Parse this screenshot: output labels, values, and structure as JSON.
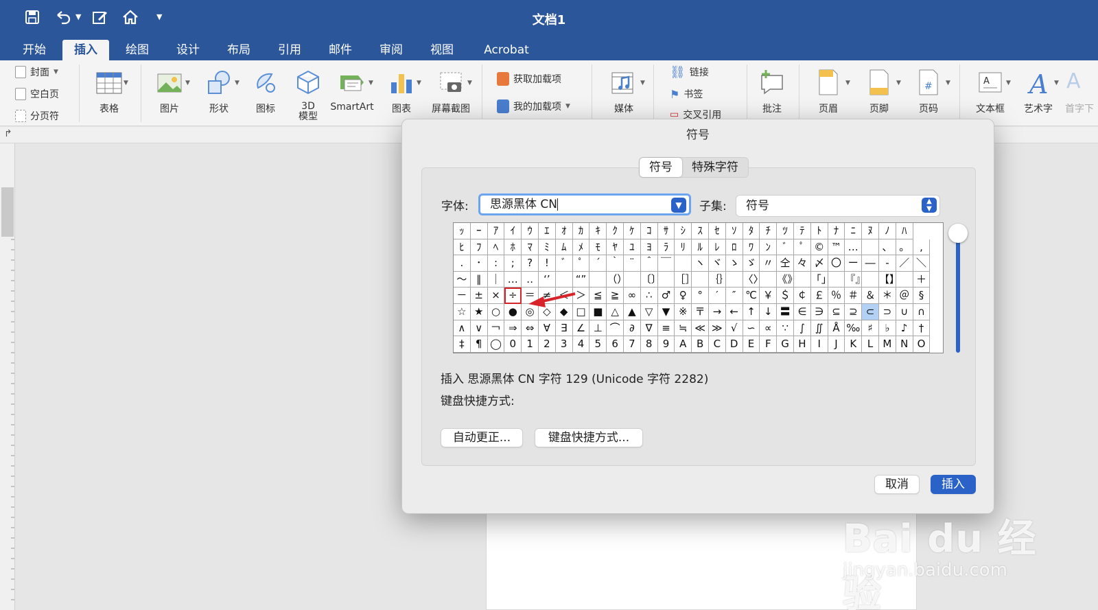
{
  "window": {
    "title": "文档1"
  },
  "quick_access": [
    "save-icon",
    "undo-icon",
    "edit-icon",
    "home-icon",
    "customize-icon"
  ],
  "tabs": [
    "开始",
    "插入",
    "绘图",
    "设计",
    "布局",
    "引用",
    "邮件",
    "审阅",
    "视图",
    "Acrobat"
  ],
  "active_tab": "插入",
  "ribbon": {
    "pages": [
      "封面",
      "空白页",
      "分页符"
    ],
    "table": "表格",
    "picture": "图片",
    "shapes": "形状",
    "icons": "图标",
    "model3d_line1": "3D",
    "model3d_line2": "模型",
    "smartart": "SmartArt",
    "chart": "图表",
    "screenshot": "屏幕截图",
    "get_addins": "获取加载项",
    "my_addins": "我的加载项",
    "media": "媒体",
    "link": "链接",
    "bookmark": "书签",
    "cross_ref": "交叉引用",
    "comment": "批注",
    "header": "页眉",
    "footer": "页脚",
    "page_number": "页码",
    "textbox": "文本框",
    "wordart": "艺术字",
    "dropcap": "首字下"
  },
  "dialog": {
    "title": "符号",
    "tabs": [
      "符号",
      "特殊字符"
    ],
    "font_label": "字体:",
    "font_value": "思源黑体 CN",
    "subset_label": "子集:",
    "subset_value": "符号",
    "info": "插入 思源黑体 CN 字符 129 (Unicode 字符 2282)",
    "shortcut_label": "键盘快捷方式:",
    "autocorrect_btn": "自动更正...",
    "keyboard_btn": "键盘快捷方式...",
    "cancel_btn": "取消",
    "insert_btn": "插入",
    "accent_color": "#2a62c8",
    "highlight_color": "#d8232a",
    "grid": [
      [
        "ｯ",
        "ｰ",
        "ｱ",
        "ｲ",
        "ｳ",
        "ｴ",
        "ｵ",
        "ｶ",
        "ｷ",
        "ｸ",
        "ｹ",
        "ｺ",
        "ｻ",
        "ｼ",
        "ｽ",
        "ｾ",
        "ｿ",
        "ﾀ",
        "ﾁ",
        "ﾂ",
        "ﾃ",
        "ﾄ",
        "ﾅ",
        "ﾆ",
        "ﾇ",
        "ﾉ",
        "ﾊ"
      ],
      [
        "ﾋ",
        "ﾌ",
        "ﾍ",
        "ﾎ",
        "ﾏ",
        "ﾐ",
        "ﾑ",
        "ﾒ",
        "ﾓ",
        "ﾔ",
        "ﾕ",
        "ﾖ",
        "ﾗ",
        "ﾘ",
        "ﾙ",
        "ﾚ",
        "ﾛ",
        "ﾜ",
        "ﾝ",
        "ﾞ",
        "ﾟ",
        "©",
        "™",
        "…",
        "",
        "、",
        "。",
        ","
      ],
      [
        ".",
        "･",
        ":",
        ";",
        "?",
        "!",
        "ﾞ",
        "ﾟ",
        "´",
        "｀",
        "¨",
        "＾",
        "￣",
        "",
        "ヽ",
        "ヾ",
        "ゝ",
        "ゞ",
        "〃",
        "仝",
        "々",
        "〆",
        "〇",
        "ー",
        "―",
        "‐",
        "／",
        "＼"
      ],
      [
        "～",
        "∥",
        "｜",
        "…",
        "‥",
        "‘’",
        "",
        "“”",
        "",
        "（）",
        "",
        "〔〕",
        "",
        "［］",
        "",
        "｛｝",
        "",
        "〈〉",
        "",
        "《》",
        "",
        "「」",
        "",
        "『』",
        "",
        "【】",
        "",
        "＋"
      ],
      [
        "－",
        "±",
        "×",
        "÷",
        "＝",
        "≠",
        "＜",
        "＞",
        "≦",
        "≧",
        "∞",
        "∴",
        "♂",
        "♀",
        "°",
        "′",
        "″",
        "℃",
        "￥",
        "＄",
        "￠",
        "￡",
        "％",
        "＃",
        "＆",
        "＊",
        "＠",
        "§"
      ],
      [
        "☆",
        "★",
        "○",
        "●",
        "◎",
        "◇",
        "◆",
        "□",
        "■",
        "△",
        "▲",
        "▽",
        "▼",
        "※",
        "〒",
        "→",
        "←",
        "↑",
        "↓",
        "〓",
        "∈",
        "∋",
        "⊆",
        "⊇",
        "⊂",
        "⊃",
        "∪",
        "∩"
      ],
      [
        "∧",
        "∨",
        "￢",
        "⇒",
        "⇔",
        "∀",
        "∃",
        "∠",
        "⊥",
        "⌒",
        "∂",
        "∇",
        "≡",
        "≒",
        "≪",
        "≫",
        "√",
        "∽",
        "∝",
        "∵",
        "∫",
        "∬",
        "Å",
        "‰",
        "♯",
        "♭",
        "♪",
        "†"
      ],
      [
        "‡",
        "¶",
        "◯",
        "0",
        "1",
        "2",
        "3",
        "4",
        "5",
        "6",
        "7",
        "8",
        "9",
        "A",
        "B",
        "C",
        "D",
        "E",
        "F",
        "G",
        "H",
        "I",
        "J",
        "K",
        "L",
        "M",
        "N",
        "O"
      ]
    ]
  },
  "watermark": {
    "main": "Bai du 经验",
    "sub": "jingyan.baidu.com"
  }
}
